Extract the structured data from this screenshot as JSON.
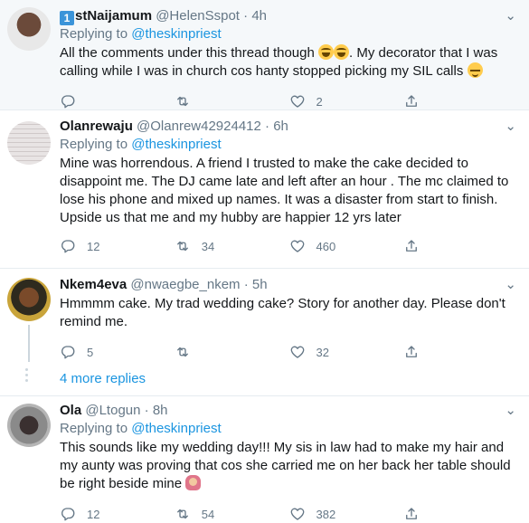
{
  "tweets": [
    {
      "badge": "1",
      "name_rest": "stNaijamum",
      "handle": "@HelenSspot",
      "dot": "·",
      "time": "4h",
      "replying_label": "Replying to",
      "replying_to": "@theskinpriest",
      "text_1": "All the comments under this thread though ",
      "text_2": ". My decorator that I was calling while I was in church cos hanty stopped picking my SIL calls ",
      "emoji": [
        "face-with-tears-of-joy",
        "face-with-tears-of-joy",
        "relieved-face"
      ],
      "actions": {
        "reply": "",
        "retweet": "",
        "like": "2"
      }
    },
    {
      "name": "Olanrewaju",
      "handle": "@Olanrew42924412",
      "dot": "·",
      "time": "6h",
      "replying_label": "Replying to",
      "replying_to": "@theskinpriest",
      "text": "Mine was horrendous.  A friend I trusted to make the cake decided to disappoint me. The DJ came late and left after an hour . The mc claimed to lose his phone and mixed up names. It was a disaster from start to finish. Upside us that me and my hubby are happier 12 yrs later",
      "actions": {
        "reply": "12",
        "retweet": "34",
        "like": "460"
      }
    },
    {
      "name": "Nkem4eva",
      "handle": "@nwaegbe_nkem",
      "dot": "·",
      "time": "5h",
      "text": "Hmmmm cake. My trad wedding cake? Story for another day. Please don't remind me.",
      "actions": {
        "reply": "5",
        "retweet": "",
        "like": "32"
      }
    },
    {
      "name": "Ola",
      "handle": "@Ltogun",
      "dot": "·",
      "time": "8h",
      "replying_label": "Replying to",
      "replying_to": "@theskinpriest",
      "text": "This sounds like my wedding day!!! My sis in law had to make my hair and my aunty was proving that cos she carried me on her back her table should be right beside mine ",
      "emoji": [
        "woman-facepalming"
      ],
      "actions": {
        "reply": "12",
        "retweet": "54",
        "like": "382"
      }
    }
  ],
  "show_more_replies": "4 more replies",
  "more_glyph": "⌄",
  "icons": [
    "reply-icon",
    "retweet-icon",
    "like-icon",
    "share-icon"
  ],
  "colors": {
    "link": "#1b95e0",
    "muted": "#657786",
    "highlight_bg": "#f5f8fa",
    "badge": "#3b94d9"
  }
}
